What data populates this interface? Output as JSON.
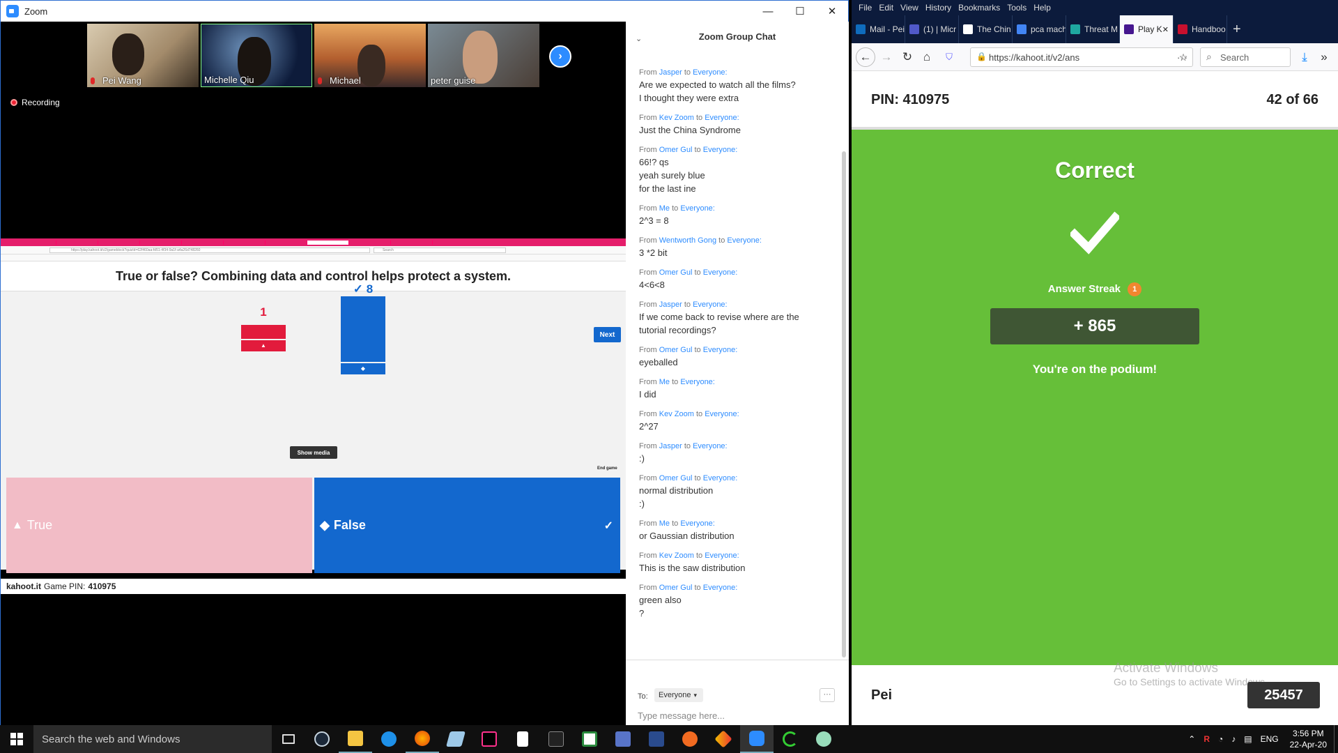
{
  "zoom": {
    "title": "Zoom",
    "window_controls": [
      "—",
      "☐",
      "✕"
    ],
    "participants": [
      {
        "name": "Pei Wang",
        "muted": true
      },
      {
        "name": "Michelle Qiu",
        "muted": false
      },
      {
        "name": "Michael",
        "muted": true
      },
      {
        "name": "peter guise",
        "muted": false
      }
    ],
    "next_arrow": "›",
    "recording": "Recording",
    "share": {
      "question": "True or false? Combining data and control helps protect a system.",
      "next": "Next",
      "true_count": "1",
      "false_count": "✓ 8",
      "show_media": "Show media",
      "end_game": "End game",
      "answer_true": "True",
      "answer_false": "False",
      "footer_site": "kahoot.it",
      "footer_pin_label": "Game PIN:",
      "footer_pin": "410975",
      "url": "https://play.kahoot.it/v2/gameblock?quizId=62f460aa-fd51-4f34-9a1f-a4a26d748260",
      "search": "Search"
    }
  },
  "chat": {
    "header": "Zoom Group Chat",
    "from_label": "From",
    "to_label": "to",
    "messages": [
      {
        "from": "Jasper",
        "to": "Everyone:",
        "lines": [
          "Are we expected to watch all the films?",
          "I thought they were extra"
        ]
      },
      {
        "from": "Kev Zoom",
        "to": "Everyone:",
        "lines": [
          "Just the China Syndrome"
        ]
      },
      {
        "from": "Omer Gul",
        "to": "Everyone:",
        "lines": [
          "66!? qs",
          "yeah surely blue",
          "for the last ine"
        ]
      },
      {
        "from": "Me",
        "to": "Everyone:",
        "lines": [
          "2^3 = 8"
        ]
      },
      {
        "from": "Wentworth Gong",
        "to": "Everyone:",
        "lines": [
          "3 *2 bit"
        ]
      },
      {
        "from": "Omer Gul",
        "to": "Everyone:",
        "lines": [
          "4<6<8"
        ]
      },
      {
        "from": "Jasper",
        "to": "Everyone:",
        "lines": [
          "If we come back to revise where are the",
          "tutorial recordings?"
        ]
      },
      {
        "from": "Omer Gul",
        "to": "Everyone:",
        "lines": [
          "eyeballed"
        ]
      },
      {
        "from": "Me",
        "to": "Everyone:",
        "lines": [
          "I did"
        ]
      },
      {
        "from": "Kev Zoom",
        "to": "Everyone:",
        "lines": [
          "2^27"
        ]
      },
      {
        "from": "Jasper",
        "to": "Everyone:",
        "lines": [
          ":)"
        ]
      },
      {
        "from": "Omer Gul",
        "to": "Everyone:",
        "lines": [
          "normal distribution",
          ":)"
        ]
      },
      {
        "from": "Me",
        "to": "Everyone:",
        "lines": [
          "or Gaussian distribution"
        ]
      },
      {
        "from": "Kev Zoom",
        "to": "Everyone:",
        "lines": [
          "This is the saw distribution"
        ]
      },
      {
        "from": "Omer Gul",
        "to": "Everyone:",
        "lines": [
          "green also",
          "?"
        ]
      }
    ],
    "to": "To:",
    "recipient": "Everyone",
    "more": "···",
    "placeholder": "Type message here..."
  },
  "firefox": {
    "menu": [
      "File",
      "Edit",
      "View",
      "History",
      "Bookmarks",
      "Tools",
      "Help"
    ],
    "tabs": [
      {
        "label": "Mail - Pei",
        "color": "#0f6cbd"
      },
      {
        "label": "(1) | Micr",
        "color": "#5059c9"
      },
      {
        "label": "The Chin",
        "color": "#ffffff"
      },
      {
        "label": "pca mach",
        "color": "#4285f4"
      },
      {
        "label": "Threat M",
        "color": "#1fa8a0"
      },
      {
        "label": "Play K",
        "color": "#46178f",
        "active": true
      },
      {
        "label": "Handboo",
        "color": "#c8102e"
      }
    ],
    "url": "https://kahoot.it/v2/ans",
    "search": "Search",
    "kahoot": {
      "pin": "PIN: 410975",
      "progress": "42 of 66",
      "result": "Correct",
      "streak_label": "Answer Streak",
      "streak": "1",
      "points": "+ 865",
      "podium": "You're on the podium!",
      "player": "Pei",
      "score": "25457",
      "bg_color": "#66bf39"
    },
    "watermark_1": "Activate Windows",
    "watermark_2": "Go to Settings to activate Windows."
  },
  "taskbar": {
    "search": "Search the web and Windows",
    "lang": "ENG",
    "time": "3:56 PM",
    "date": "22-Apr-20"
  }
}
